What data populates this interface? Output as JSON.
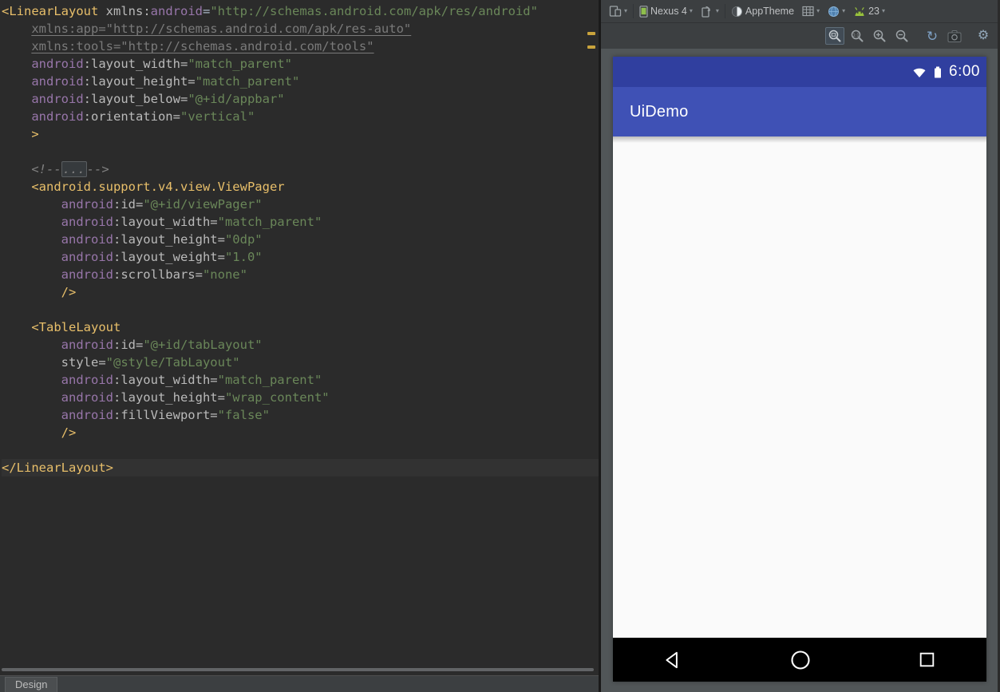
{
  "editor": {
    "tab_label": "Design",
    "syntax_colors": {
      "tag": "#e8bf6a",
      "ns": "#9876aa",
      "at": "#bababa",
      "st": "#6a8759",
      "cm": "#808080",
      "gu": "#7a7a7a",
      "pl": "#a9b7c6",
      "background": "#2b2b2b",
      "caret_line": "#323232",
      "warning_stripe": "#c9a33c"
    },
    "lines": [
      {
        "tk": [
          {
            "t": "<LinearLayout",
            "c": "tag"
          },
          {
            "t": " ",
            "c": "pl"
          },
          {
            "t": "xmlns:",
            "c": "at"
          },
          {
            "t": "android",
            "c": "ns"
          },
          {
            "t": "=",
            "c": "pl"
          },
          {
            "t": "\"http://schemas.android.com/apk/res/android\"",
            "c": "st"
          }
        ]
      },
      {
        "tk": [
          {
            "t": "    ",
            "c": "pl"
          },
          {
            "t": "xmlns:app=\"http://schemas.android.com/apk/res-auto\"",
            "c": "gu"
          }
        ]
      },
      {
        "tk": [
          {
            "t": "    ",
            "c": "pl"
          },
          {
            "t": "xmlns:tools=\"http://schemas.android.com/tools\"",
            "c": "gu"
          }
        ]
      },
      {
        "tk": [
          {
            "t": "    ",
            "c": "pl"
          },
          {
            "t": "android",
            "c": "ns"
          },
          {
            "t": ":layout_width=",
            "c": "at"
          },
          {
            "t": "\"match_parent\"",
            "c": "st"
          }
        ]
      },
      {
        "tk": [
          {
            "t": "    ",
            "c": "pl"
          },
          {
            "t": "android",
            "c": "ns"
          },
          {
            "t": ":layout_height=",
            "c": "at"
          },
          {
            "t": "\"match_parent\"",
            "c": "st"
          }
        ]
      },
      {
        "tk": [
          {
            "t": "    ",
            "c": "pl"
          },
          {
            "t": "android",
            "c": "ns"
          },
          {
            "t": ":layout_below=",
            "c": "at"
          },
          {
            "t": "\"@+id/appbar\"",
            "c": "st"
          }
        ]
      },
      {
        "tk": [
          {
            "t": "    ",
            "c": "pl"
          },
          {
            "t": "android",
            "c": "ns"
          },
          {
            "t": ":orientation=",
            "c": "at"
          },
          {
            "t": "\"vertical\"",
            "c": "st"
          }
        ]
      },
      {
        "tk": [
          {
            "t": "    ",
            "c": "pl"
          },
          {
            "t": ">",
            "c": "tag"
          }
        ]
      },
      {
        "tk": []
      },
      {
        "tk": [
          {
            "t": "    ",
            "c": "pl"
          },
          {
            "t": "<!--",
            "c": "cm"
          },
          {
            "t": "...",
            "c": "fo"
          },
          {
            "t": "-->",
            "c": "cm"
          }
        ]
      },
      {
        "tk": [
          {
            "t": "    ",
            "c": "pl"
          },
          {
            "t": "<android.support.v4.view.ViewPager",
            "c": "tag"
          }
        ]
      },
      {
        "tk": [
          {
            "t": "        ",
            "c": "pl"
          },
          {
            "t": "android",
            "c": "ns"
          },
          {
            "t": ":id=",
            "c": "at"
          },
          {
            "t": "\"@+id/viewPager\"",
            "c": "st"
          }
        ]
      },
      {
        "tk": [
          {
            "t": "        ",
            "c": "pl"
          },
          {
            "t": "android",
            "c": "ns"
          },
          {
            "t": ":layout_width=",
            "c": "at"
          },
          {
            "t": "\"match_parent\"",
            "c": "st"
          }
        ]
      },
      {
        "tk": [
          {
            "t": "        ",
            "c": "pl"
          },
          {
            "t": "android",
            "c": "ns"
          },
          {
            "t": ":layout_height=",
            "c": "at"
          },
          {
            "t": "\"0dp\"",
            "c": "st"
          }
        ]
      },
      {
        "tk": [
          {
            "t": "        ",
            "c": "pl"
          },
          {
            "t": "android",
            "c": "ns"
          },
          {
            "t": ":layout_weight=",
            "c": "at"
          },
          {
            "t": "\"1.0\"",
            "c": "st"
          }
        ]
      },
      {
        "tk": [
          {
            "t": "        ",
            "c": "pl"
          },
          {
            "t": "android",
            "c": "ns"
          },
          {
            "t": ":scrollbars=",
            "c": "at"
          },
          {
            "t": "\"none\"",
            "c": "st"
          }
        ]
      },
      {
        "tk": [
          {
            "t": "        ",
            "c": "pl"
          },
          {
            "t": "/>",
            "c": "tag"
          }
        ]
      },
      {
        "tk": []
      },
      {
        "tk": [
          {
            "t": "    ",
            "c": "pl"
          },
          {
            "t": "<TableLayout",
            "c": "tag"
          }
        ]
      },
      {
        "tk": [
          {
            "t": "        ",
            "c": "pl"
          },
          {
            "t": "android",
            "c": "ns"
          },
          {
            "t": ":id=",
            "c": "at"
          },
          {
            "t": "\"@+id/tabLayout\"",
            "c": "st"
          }
        ]
      },
      {
        "tk": [
          {
            "t": "        ",
            "c": "pl"
          },
          {
            "t": "style=",
            "c": "at"
          },
          {
            "t": "\"@style/TabLayout\"",
            "c": "st"
          }
        ]
      },
      {
        "tk": [
          {
            "t": "        ",
            "c": "pl"
          },
          {
            "t": "android",
            "c": "ns"
          },
          {
            "t": ":layout_width=",
            "c": "at"
          },
          {
            "t": "\"match_parent\"",
            "c": "st"
          }
        ]
      },
      {
        "tk": [
          {
            "t": "        ",
            "c": "pl"
          },
          {
            "t": "android",
            "c": "ns"
          },
          {
            "t": ":layout_height=",
            "c": "at"
          },
          {
            "t": "\"wrap_content\"",
            "c": "st"
          }
        ]
      },
      {
        "tk": [
          {
            "t": "        ",
            "c": "pl"
          },
          {
            "t": "android",
            "c": "ns"
          },
          {
            "t": ":fillViewport=",
            "c": "at"
          },
          {
            "t": "\"false\"",
            "c": "st"
          }
        ]
      },
      {
        "tk": [
          {
            "t": "        ",
            "c": "pl"
          },
          {
            "t": "/>",
            "c": "tag"
          }
        ]
      },
      {
        "tk": []
      },
      {
        "tk": [
          {
            "t": "</LinearLayout>",
            "c": "tag"
          }
        ],
        "hl": true
      }
    ]
  },
  "preview_toolbar": {
    "device_label": "Nexus 4",
    "theme_label": "AppTheme",
    "api_level": "23",
    "chevron": "▾",
    "refresh_glyph": "↻",
    "gear_glyph": "⚙",
    "icon_names": [
      "design-surface-icon",
      "device-phone-icon",
      "orientation-icon",
      "theme-circle-icon",
      "config-grid-icon",
      "locale-globe-icon",
      "android-api-icon",
      "zoom-fit-icon",
      "zoom-actual-icon",
      "zoom-in-icon",
      "zoom-out-icon",
      "refresh-icon",
      "camera-icon",
      "gear-icon"
    ]
  },
  "device_preview": {
    "status_time": "6:00",
    "app_title": "UiDemo",
    "nav_icon_names": [
      "nav-back-icon",
      "nav-home-icon",
      "nav-recents-icon"
    ],
    "colors": {
      "statusbar": "#303F9F",
      "appbar": "#3F51B5",
      "content": "#FAFAFA",
      "navbar": "#000000"
    }
  }
}
